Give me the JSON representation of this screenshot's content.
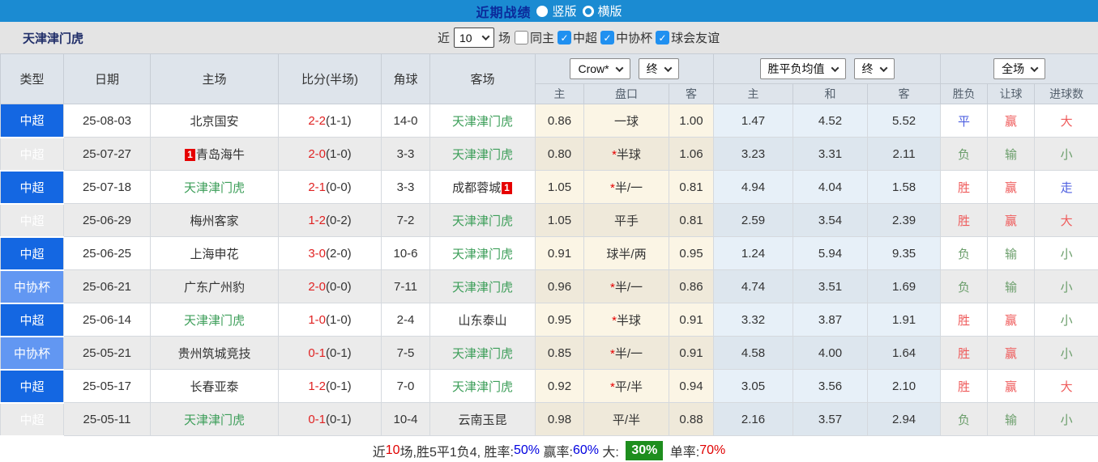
{
  "topbar": {
    "title": "近期战绩",
    "options": [
      {
        "label": "竖版",
        "selected": true
      },
      {
        "label": "横版",
        "selected": false
      }
    ]
  },
  "filterbar": {
    "team": "天津津门虎",
    "recent_label": "近",
    "recent_value": "10",
    "unit_label": "场",
    "checkboxes": [
      {
        "label": "同主",
        "checked": false
      },
      {
        "label": "中超",
        "checked": true
      },
      {
        "label": "中协杯",
        "checked": true
      },
      {
        "label": "球会友谊",
        "checked": true
      }
    ]
  },
  "table": {
    "main_headers": {
      "type": "类型",
      "date": "日期",
      "home": "主场",
      "score": "比分(半场)",
      "corner": "角球",
      "away": "客场"
    },
    "selects": {
      "bookmaker": "Crow*",
      "bookmaker_state": "终",
      "mean": "胜平负均值",
      "mean_state": "终",
      "period": "全场"
    },
    "sub_headers": [
      "主",
      "盘口",
      "客",
      "主",
      "和",
      "客",
      "胜负",
      "让球",
      "进球数"
    ],
    "rows": [
      {
        "type": "中超",
        "cup": false,
        "date": "25-08-03",
        "home": {
          "name": "北京国安",
          "self": false,
          "badge": null
        },
        "score": "2-2",
        "half": "(1-1)",
        "corner": "14-0",
        "away": {
          "name": "天津津门虎",
          "self": true,
          "badge": null
        },
        "crow": {
          "home": "0.86",
          "handicap": "一球",
          "star": false,
          "away": "1.00"
        },
        "mean": {
          "home": "1.47",
          "draw": "4.52",
          "away": "5.52"
        },
        "results": [
          {
            "t": "平",
            "c": "blue"
          },
          {
            "t": "赢",
            "c": "red"
          },
          {
            "t": "大",
            "c": "red"
          }
        ]
      },
      {
        "type": "中超",
        "cup": false,
        "date": "25-07-27",
        "home": {
          "name": "青岛海牛",
          "self": false,
          "badge": "1"
        },
        "score": "2-0",
        "half": "(1-0)",
        "corner": "3-3",
        "away": {
          "name": "天津津门虎",
          "self": true,
          "badge": null
        },
        "crow": {
          "home": "0.80",
          "handicap": "半球",
          "star": true,
          "away": "1.06"
        },
        "mean": {
          "home": "3.23",
          "draw": "3.31",
          "away": "2.11"
        },
        "results": [
          {
            "t": "负",
            "c": "green"
          },
          {
            "t": "输",
            "c": "green"
          },
          {
            "t": "小",
            "c": "green"
          }
        ]
      },
      {
        "type": "中超",
        "cup": false,
        "date": "25-07-18",
        "home": {
          "name": "天津津门虎",
          "self": true,
          "badge": null
        },
        "score": "2-1",
        "half": "(0-0)",
        "corner": "3-3",
        "away": {
          "name": "成都蓉城",
          "self": false,
          "badge": "1"
        },
        "crow": {
          "home": "1.05",
          "handicap": "半/一",
          "star": true,
          "away": "0.81"
        },
        "mean": {
          "home": "4.94",
          "draw": "4.04",
          "away": "1.58"
        },
        "results": [
          {
            "t": "胜",
            "c": "red"
          },
          {
            "t": "赢",
            "c": "red"
          },
          {
            "t": "走",
            "c": "blue"
          }
        ]
      },
      {
        "type": "中超",
        "cup": false,
        "date": "25-06-29",
        "home": {
          "name": "梅州客家",
          "self": false,
          "badge": null
        },
        "score": "1-2",
        "half": "(0-2)",
        "corner": "7-2",
        "away": {
          "name": "天津津门虎",
          "self": true,
          "badge": null
        },
        "crow": {
          "home": "1.05",
          "handicap": "平手",
          "star": false,
          "away": "0.81"
        },
        "mean": {
          "home": "2.59",
          "draw": "3.54",
          "away": "2.39"
        },
        "results": [
          {
            "t": "胜",
            "c": "red"
          },
          {
            "t": "赢",
            "c": "red"
          },
          {
            "t": "大",
            "c": "red"
          }
        ]
      },
      {
        "type": "中超",
        "cup": false,
        "date": "25-06-25",
        "home": {
          "name": "上海申花",
          "self": false,
          "badge": null
        },
        "score": "3-0",
        "half": "(2-0)",
        "corner": "10-6",
        "away": {
          "name": "天津津门虎",
          "self": true,
          "badge": null
        },
        "crow": {
          "home": "0.91",
          "handicap": "球半/两",
          "star": false,
          "away": "0.95"
        },
        "mean": {
          "home": "1.24",
          "draw": "5.94",
          "away": "9.35"
        },
        "results": [
          {
            "t": "负",
            "c": "green"
          },
          {
            "t": "输",
            "c": "green"
          },
          {
            "t": "小",
            "c": "green"
          }
        ]
      },
      {
        "type": "中协杯",
        "cup": true,
        "date": "25-06-21",
        "home": {
          "name": "广东广州豹",
          "self": false,
          "badge": null
        },
        "score": "2-0",
        "half": "(0-0)",
        "corner": "7-11",
        "away": {
          "name": "天津津门虎",
          "self": true,
          "badge": null
        },
        "crow": {
          "home": "0.96",
          "handicap": "半/一",
          "star": true,
          "away": "0.86"
        },
        "mean": {
          "home": "4.74",
          "draw": "3.51",
          "away": "1.69"
        },
        "results": [
          {
            "t": "负",
            "c": "green"
          },
          {
            "t": "输",
            "c": "green"
          },
          {
            "t": "小",
            "c": "green"
          }
        ]
      },
      {
        "type": "中超",
        "cup": false,
        "date": "25-06-14",
        "home": {
          "name": "天津津门虎",
          "self": true,
          "badge": null
        },
        "score": "1-0",
        "half": "(1-0)",
        "corner": "2-4",
        "away": {
          "name": "山东泰山",
          "self": false,
          "badge": null
        },
        "crow": {
          "home": "0.95",
          "handicap": "半球",
          "star": true,
          "away": "0.91"
        },
        "mean": {
          "home": "3.32",
          "draw": "3.87",
          "away": "1.91"
        },
        "results": [
          {
            "t": "胜",
            "c": "red"
          },
          {
            "t": "赢",
            "c": "red"
          },
          {
            "t": "小",
            "c": "green"
          }
        ]
      },
      {
        "type": "中协杯",
        "cup": true,
        "date": "25-05-21",
        "home": {
          "name": "贵州筑城竞技",
          "self": false,
          "badge": null
        },
        "score": "0-1",
        "half": "(0-1)",
        "corner": "7-5",
        "away": {
          "name": "天津津门虎",
          "self": true,
          "badge": null
        },
        "crow": {
          "home": "0.85",
          "handicap": "半/一",
          "star": true,
          "away": "0.91"
        },
        "mean": {
          "home": "4.58",
          "draw": "4.00",
          "away": "1.64"
        },
        "results": [
          {
            "t": "胜",
            "c": "red"
          },
          {
            "t": "赢",
            "c": "red"
          },
          {
            "t": "小",
            "c": "green"
          }
        ]
      },
      {
        "type": "中超",
        "cup": false,
        "date": "25-05-17",
        "home": {
          "name": "长春亚泰",
          "self": false,
          "badge": null
        },
        "score": "1-2",
        "half": "(0-1)",
        "corner": "7-0",
        "away": {
          "name": "天津津门虎",
          "self": true,
          "badge": null
        },
        "crow": {
          "home": "0.92",
          "handicap": "平/半",
          "star": true,
          "away": "0.94"
        },
        "mean": {
          "home": "3.05",
          "draw": "3.56",
          "away": "2.10"
        },
        "results": [
          {
            "t": "胜",
            "c": "red"
          },
          {
            "t": "赢",
            "c": "red"
          },
          {
            "t": "大",
            "c": "red"
          }
        ]
      },
      {
        "type": "中超",
        "cup": false,
        "date": "25-05-11",
        "home": {
          "name": "天津津门虎",
          "self": true,
          "badge": null
        },
        "score": "0-1",
        "half": "(0-1)",
        "corner": "10-4",
        "away": {
          "name": "云南玉昆",
          "self": false,
          "badge": null
        },
        "crow": {
          "home": "0.98",
          "handicap": "平/半",
          "star": false,
          "away": "0.88"
        },
        "mean": {
          "home": "2.16",
          "draw": "3.57",
          "away": "2.94"
        },
        "results": [
          {
            "t": "负",
            "c": "green"
          },
          {
            "t": "输",
            "c": "green"
          },
          {
            "t": "小",
            "c": "green"
          }
        ]
      }
    ]
  },
  "summary_segments": [
    {
      "text": "近",
      "style": "plain"
    },
    {
      "text": "10",
      "style": "red"
    },
    {
      "text": "场,胜5平1负4, 胜率:",
      "style": "plain"
    },
    {
      "text": "50%",
      "style": "blue"
    },
    {
      "text": " 赢率:",
      "style": "plain"
    },
    {
      "text": "60%",
      "style": "blue"
    },
    {
      "text": " 大: ",
      "style": "plain"
    },
    {
      "text": "30%",
      "style": "badge"
    },
    {
      "text": " 单率:",
      "style": "plain"
    },
    {
      "text": "70%",
      "style": "red"
    }
  ],
  "colors": {
    "topbar_blue": "#1b8bd2",
    "title_navy": "#0b2a9b",
    "super_league_blue": "#1467e2",
    "cup_blue": "#6297f2",
    "team_self_green": "#3c9e59",
    "score_red": "#e02222",
    "result_red": "#ef5b5b",
    "result_green": "#6b9e6b",
    "result_blue": "#4d5fe0",
    "badge_red": "#e60000",
    "summary_badge_green": "#1e8e1e",
    "summary_value_blue": "#0000e0",
    "summary_value_red": "#e00000",
    "checkbox_blue": "#2090f0",
    "crow_col_cream": "#faf3e0",
    "mean_col_blue": "#e7f0f8"
  }
}
